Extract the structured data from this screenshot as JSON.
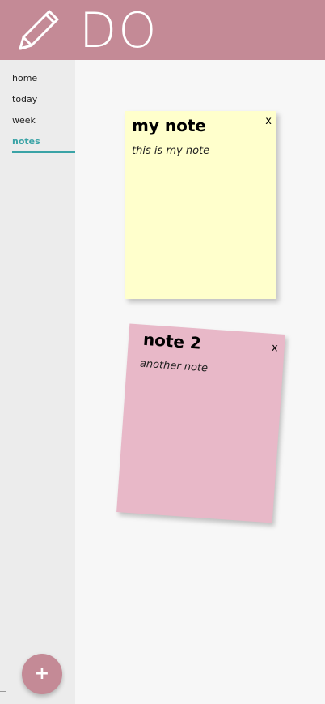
{
  "app": {
    "logo_text": "DO",
    "logo_icon": "pencil-icon"
  },
  "sidebar": {
    "items": [
      {
        "label": "home"
      },
      {
        "label": "today"
      },
      {
        "label": "week"
      },
      {
        "label": "notes",
        "active": true
      }
    ]
  },
  "notes": [
    {
      "title": "my note",
      "body": "this is my note",
      "close": "x",
      "color": "#ffffcc"
    },
    {
      "title": "note 2",
      "body": "another note",
      "close": "x",
      "color": "#e8b8c8"
    }
  ],
  "fab": {
    "label": "+"
  },
  "colors": {
    "brand": "#c48a96",
    "accent": "#3aa3a6"
  }
}
